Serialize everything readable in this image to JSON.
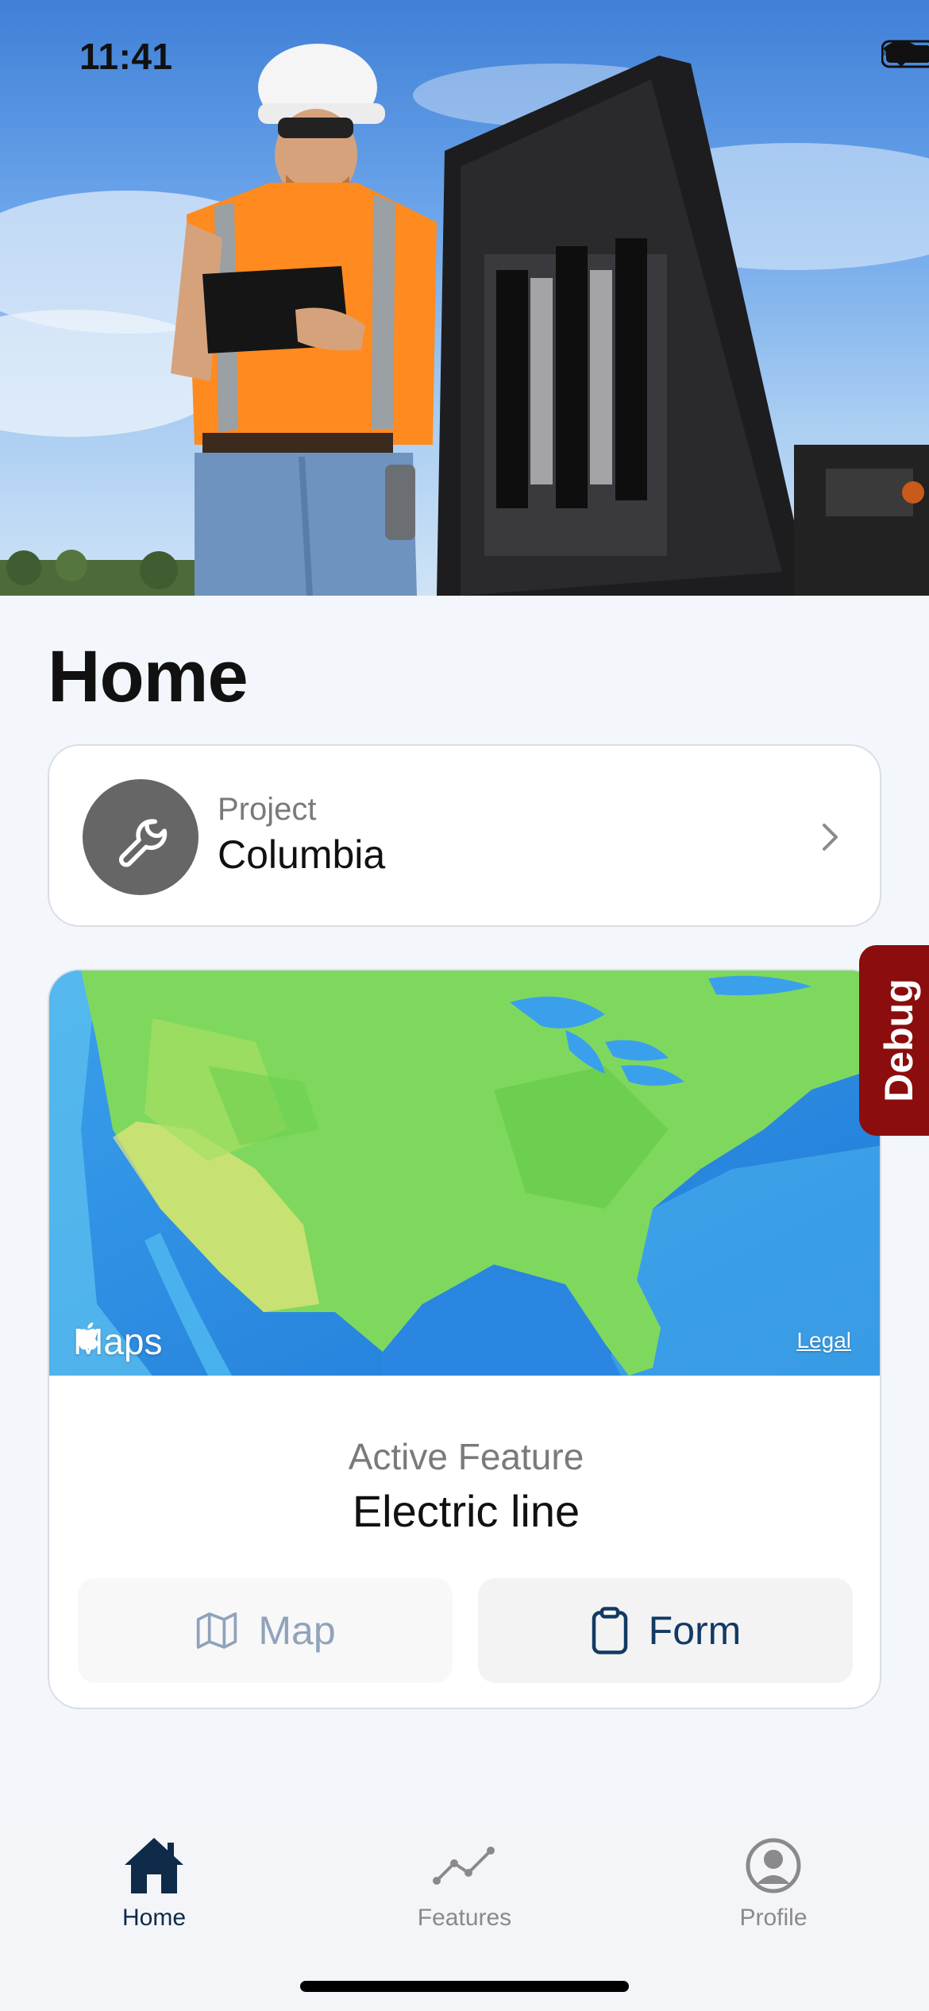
{
  "status_bar": {
    "time": "11:41"
  },
  "page": {
    "title": "Home"
  },
  "project": {
    "label": "Project",
    "name": "Columbia"
  },
  "map": {
    "brand": "Maps",
    "legal": "Legal"
  },
  "active_feature": {
    "label": "Active Feature",
    "value": "Electric line"
  },
  "actions": {
    "map_label": "Map",
    "form_label": "Form"
  },
  "debug": {
    "label": "Debug"
  },
  "tabs": [
    {
      "label": "Home",
      "icon": "house-icon",
      "selected": true
    },
    {
      "label": "Features",
      "icon": "line-chart-icon",
      "selected": false
    },
    {
      "label": "Profile",
      "icon": "person-circle-icon",
      "selected": false
    }
  ],
  "colors": {
    "accent": "#0f2b4a",
    "debug": "#8b0d0d",
    "avatar": "#666666"
  }
}
